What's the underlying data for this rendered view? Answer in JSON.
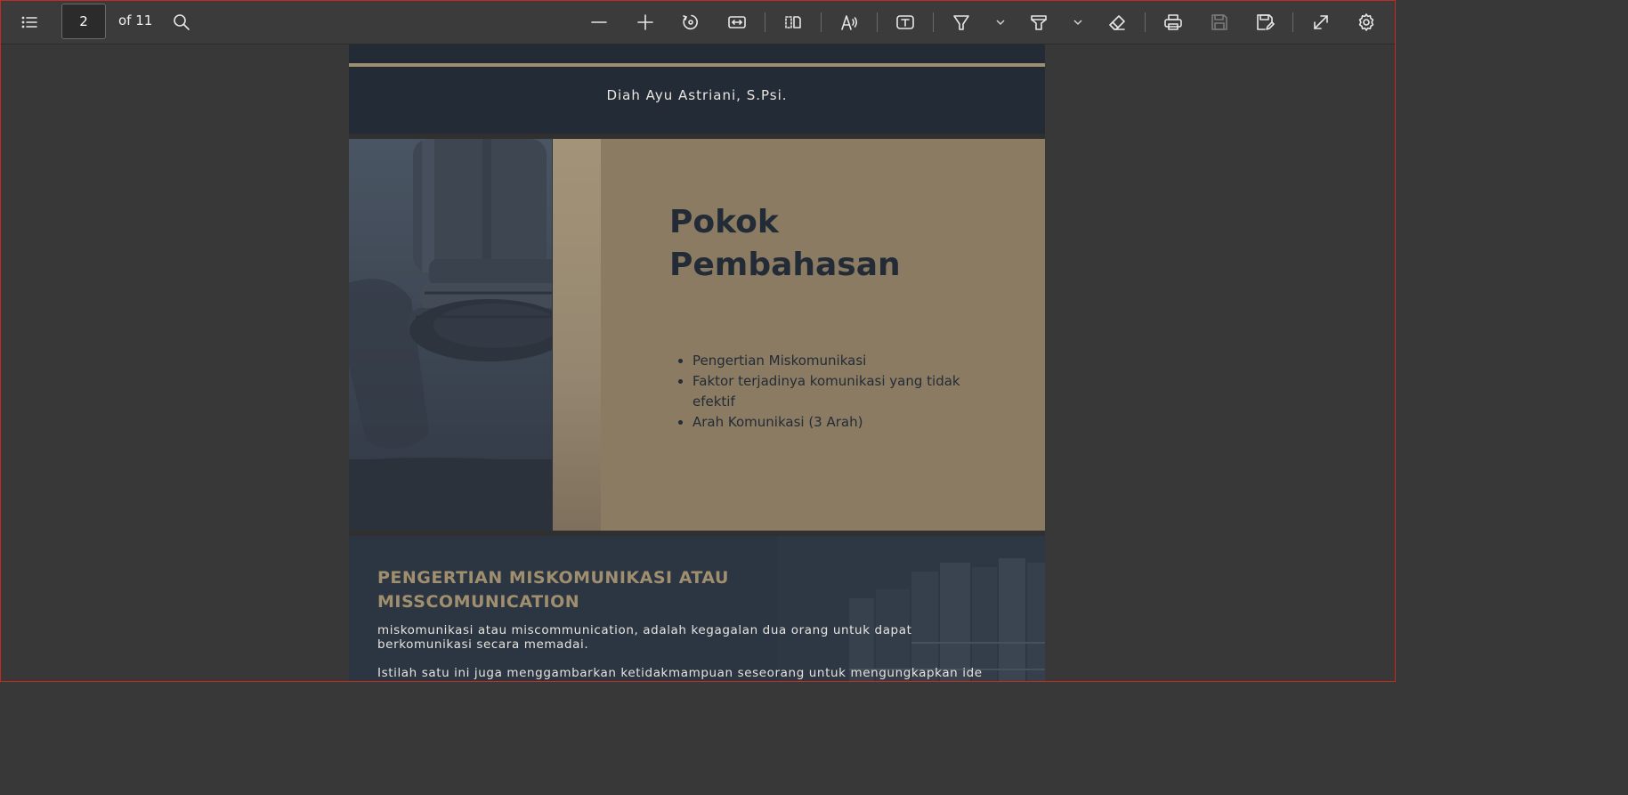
{
  "toolbar": {
    "page_current": "2",
    "page_total": "of 11",
    "icons": [
      "contents-icon",
      "search-icon",
      "zoom-out-icon",
      "zoom-in-icon",
      "rotate-icon",
      "fit-width-icon",
      "two-page-view-icon",
      "read-aloud-icon",
      "text-box-icon",
      "draw-icon",
      "highlight-icon",
      "erase-icon",
      "print-icon",
      "save-icon",
      "save-as-icon",
      "fullscreen-icon",
      "settings-icon"
    ]
  },
  "document": {
    "slide1": {
      "author": "Diah Ayu Astriani, S.Psi."
    },
    "slide2": {
      "title": "Pokok Pembahasan",
      "bullets": [
        "Pengertian Miskomunikasi",
        "Faktor terjadinya komunikasi yang tidak efektif",
        "Arah Komunikasi (3 Arah)"
      ]
    },
    "slide3": {
      "heading": "PENGERTIAN MISKOMUNIKASI ATAU MISSCOMUNICATION",
      "paragraph1": "miskomunikasi atau miscommunication, adalah kegagalan dua orang untuk dapat berkomunikasi secara memadai.",
      "paragraph2": "Istilah satu ini juga menggambarkan ketidakmampuan seseorang untuk mengungkapkan ide"
    }
  },
  "colors": {
    "toolbar_bg": "#3b3b3b",
    "viewer_bg": "#383838",
    "slide_navy": "#232c36",
    "slide_tan": "#8a7b62",
    "accent_gold": "#a08f6e"
  }
}
